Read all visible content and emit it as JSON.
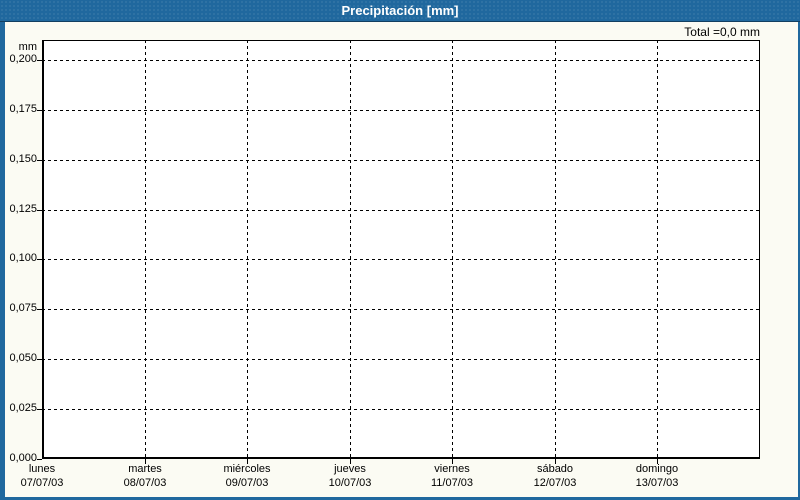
{
  "colors": {
    "titlebar_blue": "#20689E",
    "titlebar_edge": "#123F61",
    "window_border_blue": "#20689E",
    "window_background": "#FBFBF3",
    "plot_background": "#FFFFFF",
    "grid_color": "#000000",
    "title_text": "#FFFFFF",
    "label_text": "#000000"
  },
  "chart_data": {
    "type": "bar",
    "title": "Precipitación [mm]",
    "total_text": "Total =0,0 mm",
    "total_mm": 0.0,
    "ylabel": "mm",
    "xlabel": "",
    "legend": "none",
    "grid": {
      "horizontal": "dashed",
      "vertical": "dashed",
      "color": "#000000"
    },
    "ylim": [
      0,
      0.21
    ],
    "ytick_step": 0.025,
    "yticks": [
      {
        "value": 0.2,
        "label": "0,200"
      },
      {
        "value": 0.175,
        "label": "0,175"
      },
      {
        "value": 0.15,
        "label": "0,150"
      },
      {
        "value": 0.125,
        "label": "0,125"
      },
      {
        "value": 0.1,
        "label": "0,100"
      },
      {
        "value": 0.075,
        "label": "0,075"
      },
      {
        "value": 0.05,
        "label": "0,050"
      },
      {
        "value": 0.025,
        "label": "0,025"
      },
      {
        "value": 0.0,
        "label": "0,000"
      }
    ],
    "categories": [
      "lunes 07/07/03",
      "martes 08/07/03",
      "miércoles 09/07/03",
      "jueves 10/07/03",
      "viernes 11/07/03",
      "sábado 12/07/03",
      "domingo 13/07/03"
    ],
    "values": [
      0,
      0,
      0,
      0,
      0,
      0,
      0
    ],
    "x_labels": [
      {
        "day": "lunes",
        "date": "07/07/03"
      },
      {
        "day": "martes",
        "date": "08/07/03"
      },
      {
        "day": "miércoles",
        "date": "09/07/03"
      },
      {
        "day": "jueves",
        "date": "10/07/03"
      },
      {
        "day": "viernes",
        "date": "11/07/03"
      },
      {
        "day": "sábado",
        "date": "12/07/03"
      },
      {
        "day": "domingo",
        "date": "13/07/03"
      }
    ]
  }
}
